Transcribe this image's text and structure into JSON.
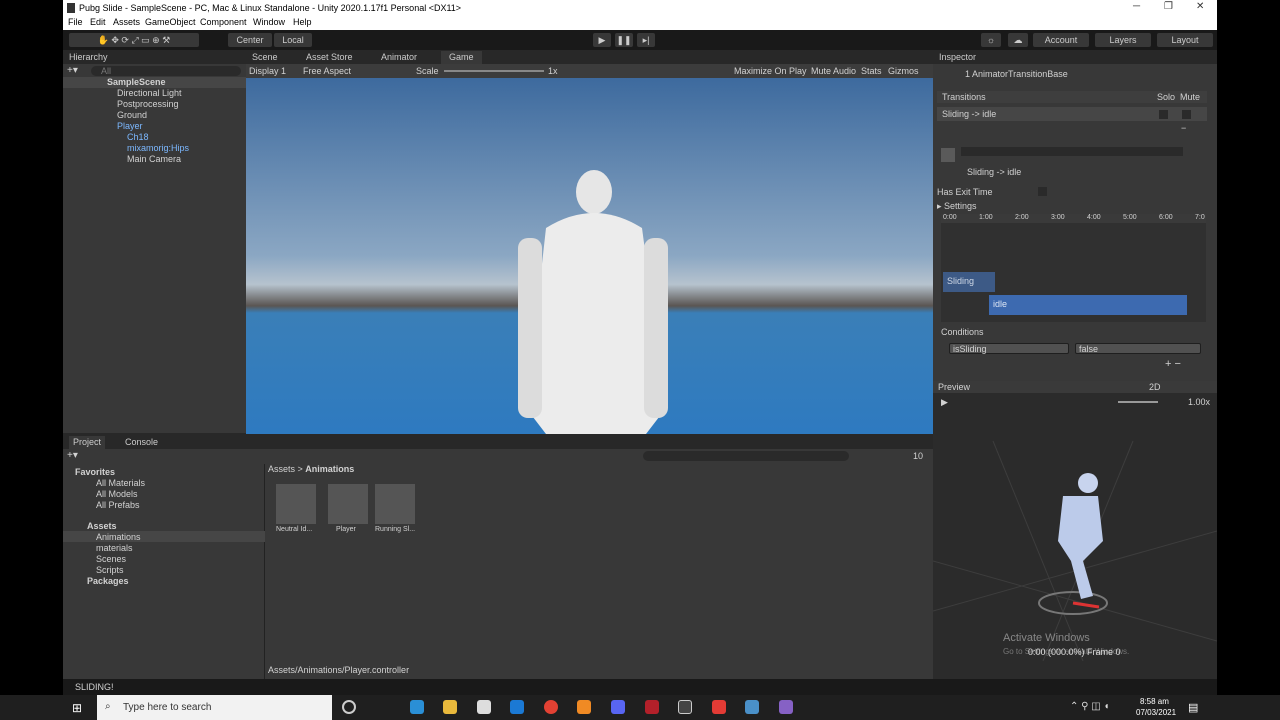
{
  "window": {
    "title": "Pubg Slide - SampleScene - PC, Mac & Linux Standalone - Unity 2020.1.17f1 Personal <DX11>"
  },
  "menu": [
    "File",
    "Edit",
    "Assets",
    "GameObject",
    "Component",
    "Window",
    "Help"
  ],
  "toolbar": {
    "pivot": "Center",
    "space": "Local",
    "account": "Account",
    "layers": "Layers",
    "layout": "Layout"
  },
  "tabs": {
    "hierarchy": "Hierarchy",
    "scene": "Scene",
    "asset_store": "Asset Store",
    "animator": "Animator",
    "game": "Game",
    "inspector": "Inspector",
    "project": "Project",
    "console": "Console"
  },
  "hierarchy": {
    "search": "All",
    "items": [
      "SampleScene",
      "Directional Light",
      "Postprocessing",
      "Ground",
      "Player",
      "Ch18",
      "mixamorig:Hips",
      "Main Camera"
    ]
  },
  "game": {
    "display": "Display 1",
    "aspect": "Free Aspect",
    "scale_label": "Scale",
    "scale_value": "1x",
    "maximize": "Maximize On Play",
    "mute": "Mute Audio",
    "stats": "Stats",
    "gizmos": "Gizmos"
  },
  "inspector": {
    "subtitle": "1 AnimatorTransitionBase",
    "transitions_label": "Transitions",
    "solo": "Solo",
    "mute": "Mute",
    "transition": "Sliding -> idle",
    "transition_name": "Sliding -> idle",
    "has_exit_time": "Has Exit Time",
    "settings": "Settings",
    "ticks": [
      "0:00",
      "1:00",
      "2:00",
      "3:00",
      "4:00",
      "5:00",
      "6:00",
      "7:0"
    ],
    "clip_a": "Sliding",
    "clip_b": "idle",
    "conditions": "Conditions",
    "cond_param": "isSliding",
    "cond_value": "false"
  },
  "preview": {
    "label": "Preview",
    "mode": "2D",
    "speed": "1.00x",
    "time": "0:00 (000.0%) Frame 0",
    "watermark1": "Activate Windows",
    "watermark2": "Go to Settings to activate Windows."
  },
  "project": {
    "favorites": "Favorites",
    "fav_items": [
      "All Materials",
      "All Models",
      "All Prefabs"
    ],
    "assets": "Assets",
    "folders": [
      "Animations",
      "materials",
      "Scenes",
      "Scripts"
    ],
    "packages": "Packages",
    "breadcrumb_root": "Assets",
    "breadcrumb_current": "Animations",
    "files": [
      "Neutral Id...",
      "Player",
      "Running Sl..."
    ],
    "path": "Assets/Animations/Player.controller",
    "count": "10"
  },
  "status": {
    "message": "SLIDING!"
  },
  "taskbar": {
    "search": "Type here to search",
    "time": "8:58 am",
    "date": "07/03/2021"
  }
}
